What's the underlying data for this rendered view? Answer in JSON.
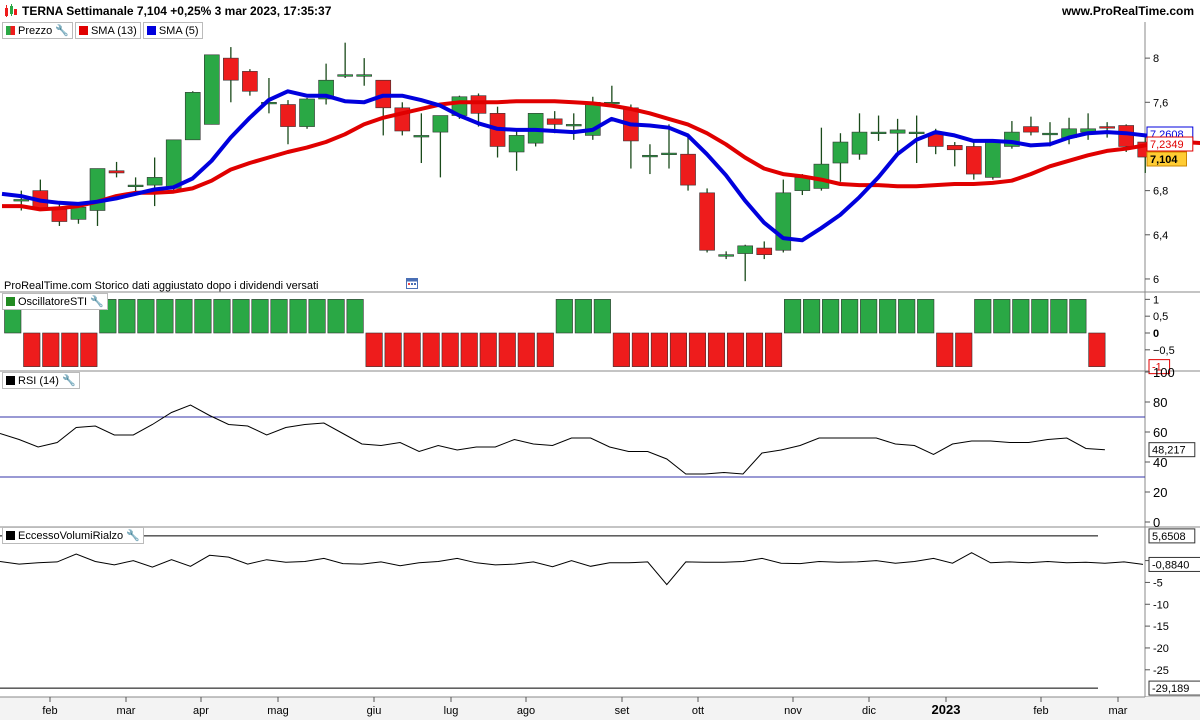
{
  "header": {
    "title": "TERNA Settimanale 7,104 +0,25% 3 mar 2023, 17:35:37",
    "site": "www.ProRealTime.com"
  },
  "legend_main": [
    {
      "label": "Prezzo",
      "color": "#228b22"
    },
    {
      "label": "SMA (13)",
      "color": "#e00000"
    },
    {
      "label": "SMA (5)",
      "color": "#0000dd"
    }
  ],
  "legend_osc": {
    "label": "OscillatoreSTI",
    "color": "#228b22"
  },
  "legend_rsi": {
    "label": "RSI (14)",
    "color": "#000000"
  },
  "legend_vol": {
    "label": "EccessoVolumiRialzo",
    "color": "#000000"
  },
  "note": "ProRealTime.com Storico dati aggiustato dopo i dividendi versati",
  "colors": {
    "up": "#2aa845",
    "down": "#ee1c1c",
    "sma13": "#e00000",
    "sma5": "#0000dd",
    "grid": "#cfcfcf"
  },
  "chart_data": [
    {
      "type": "candlestick",
      "name": "Prezzo",
      "ylim": [
        5.9,
        8.3
      ],
      "yticks": [
        "6",
        "6,4",
        "6,8",
        "7,2",
        "7,6",
        "8"
      ],
      "ytick_values": [
        6.0,
        6.4,
        6.8,
        7.2,
        7.6,
        8.0
      ],
      "price_labels": {
        "sma5": "7,2608",
        "sma13": "7,2349",
        "last": "7,104"
      },
      "candles": [
        {
          "o": 6.72,
          "h": 6.8,
          "l": 6.62,
          "c": 6.72
        },
        {
          "o": 6.8,
          "h": 6.9,
          "l": 6.62,
          "c": 6.64
        },
        {
          "o": 6.63,
          "h": 6.68,
          "l": 6.48,
          "c": 6.52
        },
        {
          "o": 6.54,
          "h": 6.68,
          "l": 6.5,
          "c": 6.65
        },
        {
          "o": 6.62,
          "h": 7.0,
          "l": 6.48,
          "c": 7.0
        },
        {
          "o": 6.98,
          "h": 7.06,
          "l": 6.92,
          "c": 6.96
        },
        {
          "o": 6.85,
          "h": 6.92,
          "l": 6.78,
          "c": 6.85
        },
        {
          "o": 6.85,
          "h": 7.1,
          "l": 6.66,
          "c": 6.92
        },
        {
          "o": 6.82,
          "h": 7.26,
          "l": 6.8,
          "c": 7.26
        },
        {
          "o": 7.26,
          "h": 7.7,
          "l": 7.26,
          "c": 7.69
        },
        {
          "o": 7.4,
          "h": 8.03,
          "l": 7.4,
          "c": 8.03
        },
        {
          "o": 8.0,
          "h": 8.1,
          "l": 7.6,
          "c": 7.8
        },
        {
          "o": 7.88,
          "h": 7.9,
          "l": 7.66,
          "c": 7.7
        },
        {
          "o": 7.6,
          "h": 7.82,
          "l": 7.5,
          "c": 7.6
        },
        {
          "o": 7.58,
          "h": 7.62,
          "l": 7.22,
          "c": 7.38
        },
        {
          "o": 7.38,
          "h": 7.64,
          "l": 7.36,
          "c": 7.63
        },
        {
          "o": 7.63,
          "h": 7.95,
          "l": 7.58,
          "c": 7.8
        },
        {
          "o": 7.85,
          "h": 8.14,
          "l": 7.82,
          "c": 7.85
        },
        {
          "o": 7.85,
          "h": 8.0,
          "l": 7.75,
          "c": 7.85
        },
        {
          "o": 7.8,
          "h": 7.8,
          "l": 7.3,
          "c": 7.55
        },
        {
          "o": 7.55,
          "h": 7.6,
          "l": 7.3,
          "c": 7.34
        },
        {
          "o": 7.3,
          "h": 7.5,
          "l": 7.05,
          "c": 7.3
        },
        {
          "o": 7.33,
          "h": 7.42,
          "l": 6.92,
          "c": 7.48
        },
        {
          "o": 7.48,
          "h": 7.66,
          "l": 7.45,
          "c": 7.65
        },
        {
          "o": 7.66,
          "h": 7.68,
          "l": 7.38,
          "c": 7.5
        },
        {
          "o": 7.5,
          "h": 7.56,
          "l": 7.1,
          "c": 7.2
        },
        {
          "o": 7.15,
          "h": 7.35,
          "l": 6.98,
          "c": 7.3
        },
        {
          "o": 7.23,
          "h": 7.45,
          "l": 7.2,
          "c": 7.5
        },
        {
          "o": 7.45,
          "h": 7.52,
          "l": 7.32,
          "c": 7.4
        },
        {
          "o": 7.4,
          "h": 7.5,
          "l": 7.26,
          "c": 7.4
        },
        {
          "o": 7.3,
          "h": 7.65,
          "l": 7.26,
          "c": 7.6
        },
        {
          "o": 7.6,
          "h": 7.75,
          "l": 7.58,
          "c": 7.6
        },
        {
          "o": 7.55,
          "h": 7.58,
          "l": 7.0,
          "c": 7.25
        },
        {
          "o": 7.12,
          "h": 7.22,
          "l": 6.95,
          "c": 7.12
        },
        {
          "o": 7.14,
          "h": 7.4,
          "l": 7.0,
          "c": 7.14
        },
        {
          "o": 7.13,
          "h": 7.3,
          "l": 6.8,
          "c": 6.85
        },
        {
          "o": 6.78,
          "h": 6.82,
          "l": 6.24,
          "c": 6.26
        },
        {
          "o": 6.22,
          "h": 6.25,
          "l": 6.18,
          "c": 6.22
        },
        {
          "o": 6.23,
          "h": 6.31,
          "l": 5.98,
          "c": 6.3
        },
        {
          "o": 6.28,
          "h": 6.34,
          "l": 6.18,
          "c": 6.22
        },
        {
          "o": 6.26,
          "h": 6.9,
          "l": 6.24,
          "c": 6.78
        },
        {
          "o": 6.8,
          "h": 6.95,
          "l": 6.76,
          "c": 6.92
        },
        {
          "o": 6.82,
          "h": 7.37,
          "l": 6.8,
          "c": 7.04
        },
        {
          "o": 7.05,
          "h": 7.32,
          "l": 6.88,
          "c": 7.24
        },
        {
          "o": 7.13,
          "h": 7.5,
          "l": 7.08,
          "c": 7.33
        },
        {
          "o": 7.33,
          "h": 7.48,
          "l": 7.25,
          "c": 7.33
        },
        {
          "o": 7.32,
          "h": 7.45,
          "l": 7.12,
          "c": 7.35
        },
        {
          "o": 7.33,
          "h": 7.48,
          "l": 7.05,
          "c": 7.33
        },
        {
          "o": 7.31,
          "h": 7.36,
          "l": 7.13,
          "c": 7.2
        },
        {
          "o": 7.21,
          "h": 7.24,
          "l": 7.02,
          "c": 7.17
        },
        {
          "o": 7.2,
          "h": 7.24,
          "l": 6.9,
          "c": 6.95
        },
        {
          "o": 6.92,
          "h": 7.26,
          "l": 6.9,
          "c": 7.24
        },
        {
          "o": 7.2,
          "h": 7.43,
          "l": 7.18,
          "c": 7.33
        },
        {
          "o": 7.38,
          "h": 7.47,
          "l": 7.3,
          "c": 7.33
        },
        {
          "o": 7.32,
          "h": 7.42,
          "l": 7.2,
          "c": 7.32
        },
        {
          "o": 7.28,
          "h": 7.46,
          "l": 7.22,
          "c": 7.36
        },
        {
          "o": 7.33,
          "h": 7.5,
          "l": 7.26,
          "c": 7.36
        },
        {
          "o": 7.38,
          "h": 7.42,
          "l": 7.28,
          "c": 7.37
        },
        {
          "o": 7.39,
          "h": 7.4,
          "l": 7.15,
          "c": 7.2
        },
        {
          "o": 7.24,
          "h": 7.29,
          "l": 6.96,
          "c": 7.104
        }
      ],
      "sma13": [
        6.66,
        6.66,
        6.63,
        6.64,
        6.66,
        6.7,
        6.75,
        6.78,
        6.78,
        6.79,
        6.82,
        6.89,
        6.99,
        7.05,
        7.1,
        7.15,
        7.19,
        7.24,
        7.31,
        7.4,
        7.46,
        7.5,
        7.54,
        7.58,
        7.6,
        7.6,
        7.6,
        7.61,
        7.61,
        7.61,
        7.6,
        7.59,
        7.57,
        7.54,
        7.5,
        7.45,
        7.4,
        7.32,
        7.22,
        7.1,
        7.0,
        6.95,
        6.93,
        6.9,
        6.86,
        6.85,
        6.85,
        6.84,
        6.84,
        6.85,
        6.86,
        6.86,
        6.87,
        6.89,
        6.95,
        7.02,
        7.07,
        7.12,
        7.16,
        7.18,
        7.21,
        7.24,
        7.24,
        7.23
      ],
      "sma5": [
        6.77,
        6.75,
        6.71,
        6.69,
        6.68,
        6.7,
        6.73,
        6.77,
        6.81,
        6.83,
        6.91,
        7.07,
        7.28,
        7.46,
        7.62,
        7.7,
        7.66,
        7.66,
        7.61,
        7.6,
        7.66,
        7.66,
        7.62,
        7.57,
        7.48,
        7.41,
        7.36,
        7.35,
        7.35,
        7.34,
        7.33,
        7.35,
        7.45,
        7.4,
        7.39,
        7.37,
        7.3,
        7.13,
        6.94,
        6.71,
        6.51,
        6.37,
        6.35,
        6.46,
        6.58,
        6.74,
        6.92,
        7.13,
        7.26,
        7.33,
        7.3,
        7.25,
        7.25,
        7.24,
        7.21,
        7.22,
        7.28,
        7.32,
        7.33,
        7.32,
        7.3,
        7.27
      ]
    },
    {
      "type": "bar",
      "name": "OscillatoreSTI",
      "ylim": [
        -1.1,
        1.1
      ],
      "yticks": [
        "1",
        "0,5",
        "0",
        "−0,5"
      ],
      "ytick_values": [
        1.0,
        0.5,
        0.0,
        -0.5
      ],
      "last_label": "-1",
      "values": [
        1,
        -1,
        -1,
        -1,
        -1,
        1,
        1,
        1,
        1,
        1,
        1,
        1,
        1,
        1,
        1,
        1,
        1,
        1,
        1,
        -1,
        -1,
        -1,
        -1,
        -1,
        -1,
        -1,
        -1,
        -1,
        -1,
        1,
        1,
        1,
        -1,
        -1,
        -1,
        -1,
        -1,
        -1,
        -1,
        -1,
        -1,
        1,
        1,
        1,
        1,
        1,
        1,
        1,
        1,
        -1,
        -1,
        1,
        1,
        1,
        1,
        1,
        1,
        -1
      ]
    },
    {
      "type": "line",
      "name": "RSI (14)",
      "ylim": [
        0,
        100
      ],
      "yticks": [
        "100",
        "80",
        "60",
        "40",
        "20",
        "0"
      ],
      "ytick_values": [
        100,
        80,
        60,
        40,
        20,
        0
      ],
      "bands": [
        70,
        30
      ],
      "last_label": "48,217",
      "values": [
        59,
        55,
        50,
        53,
        63,
        64,
        58,
        58,
        65,
        73,
        78,
        71,
        65,
        64,
        58,
        63,
        65,
        66,
        59,
        52,
        51,
        53,
        47,
        51,
        48,
        50,
        50,
        55,
        52,
        51,
        56,
        56,
        50,
        47,
        47,
        42,
        32,
        32,
        33,
        32,
        46,
        48,
        51,
        56,
        56,
        56,
        56,
        52,
        51,
        45,
        52,
        54,
        54,
        53,
        53,
        55,
        56,
        49,
        48.217
      ]
    },
    {
      "type": "line",
      "name": "EccessoVolumiRialzo",
      "ylim": [
        -31,
        7
      ],
      "yticks": [
        "0",
        "-5",
        "-10",
        "-15",
        "-20",
        "-25"
      ],
      "ytick_values": [
        0,
        -5,
        -10,
        -15,
        -20,
        -25
      ],
      "hlines": [
        5.6508,
        -29.189
      ],
      "hline_labels": [
        "5,6508",
        "-29,189"
      ],
      "last_label": "-0,8840",
      "values": [
        -0.2,
        -0.8,
        -0.5,
        -0.3,
        1.5,
        -0.2,
        -1.0,
        0,
        -1.5,
        0.2,
        -1.3,
        1.2,
        0.8,
        -0.8,
        0.2,
        -0.4,
        -0.2,
        0.5,
        -0.7,
        -0.8,
        -0.3,
        -1.2,
        -0.5,
        -0.2,
        0.5,
        -0.5,
        -1.0,
        -0.8,
        -0.3,
        -1.4,
        0,
        -1.3,
        -0.5,
        -0.5,
        -0.3,
        -5.5,
        -0.3,
        -0.4,
        -0.4,
        -0.2,
        0.5,
        -0.6,
        -0.7,
        -0.2,
        -0.4,
        -0.3,
        0,
        -0.6,
        -0.2,
        0.5,
        -0.6,
        1.8,
        -0.5,
        -0.3,
        -0.5,
        -0.2,
        -0.5,
        -0.4,
        -0.6,
        -0.3,
        -0.884
      ]
    }
  ],
  "xaxis": {
    "labels": [
      "feb",
      "mar",
      "apr",
      "mag",
      "giu",
      "lug",
      "ago",
      "set",
      "ott",
      "nov",
      "dic",
      "2023",
      "feb",
      "mar"
    ]
  }
}
